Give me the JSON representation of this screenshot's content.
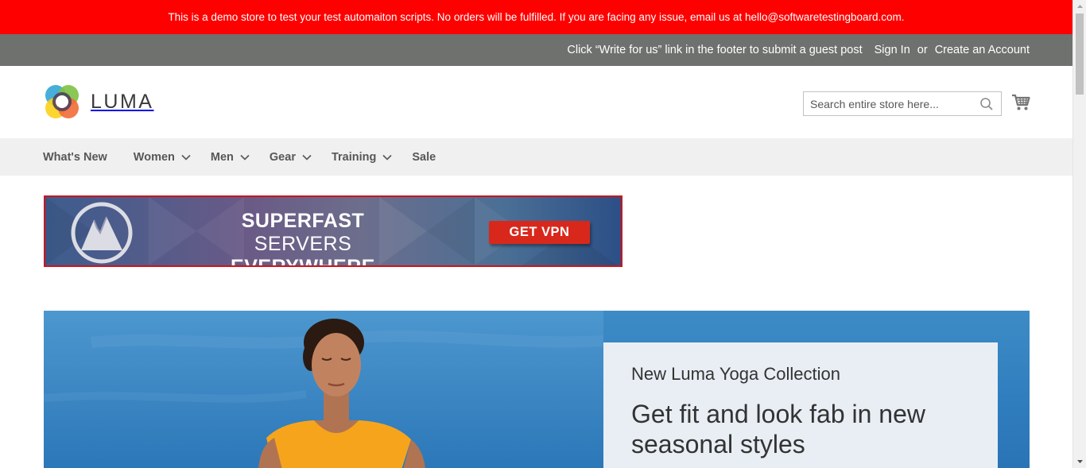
{
  "notice": {
    "text": "This is a demo store to test your test automaiton scripts. No orders will be fulfilled. If you are facing any issue, email us at hello@softwaretestingboard.com."
  },
  "header_links": {
    "guest_post": "Click “Write for us” link in the footer to submit a guest post",
    "sign_in": "Sign In",
    "or": "or",
    "create_account": "Create an Account"
  },
  "logo": {
    "text": "LUMA",
    "icon": "luma-logo-icon"
  },
  "search": {
    "placeholder": "Search entire store here...",
    "icon": "search-icon"
  },
  "cart": {
    "icon": "cart-icon"
  },
  "nav": {
    "items": [
      {
        "label": "What's New",
        "has_dropdown": false
      },
      {
        "label": "Women",
        "has_dropdown": true
      },
      {
        "label": "Men",
        "has_dropdown": true
      },
      {
        "label": "Gear",
        "has_dropdown": true
      },
      {
        "label": "Training",
        "has_dropdown": true
      },
      {
        "label": "Sale",
        "has_dropdown": false
      }
    ]
  },
  "ad": {
    "headline_bold_1": "SUPERFAST",
    "headline_light": "SERVERS",
    "headline_bold_2": "EVERYWHERE",
    "button": "GET VPN",
    "icon": "mountain-logo-icon"
  },
  "hero": {
    "eyebrow": "New Luma Yoga Collection",
    "title": "Get fit and look fab in new seasonal styles"
  },
  "colors": {
    "notice_bg": "#ff0000",
    "header_bar_bg": "#6e716e",
    "nav_bg": "#f0f0f0",
    "ad_button": "#d8281c",
    "hero_card_bg": "#e8eef4"
  }
}
